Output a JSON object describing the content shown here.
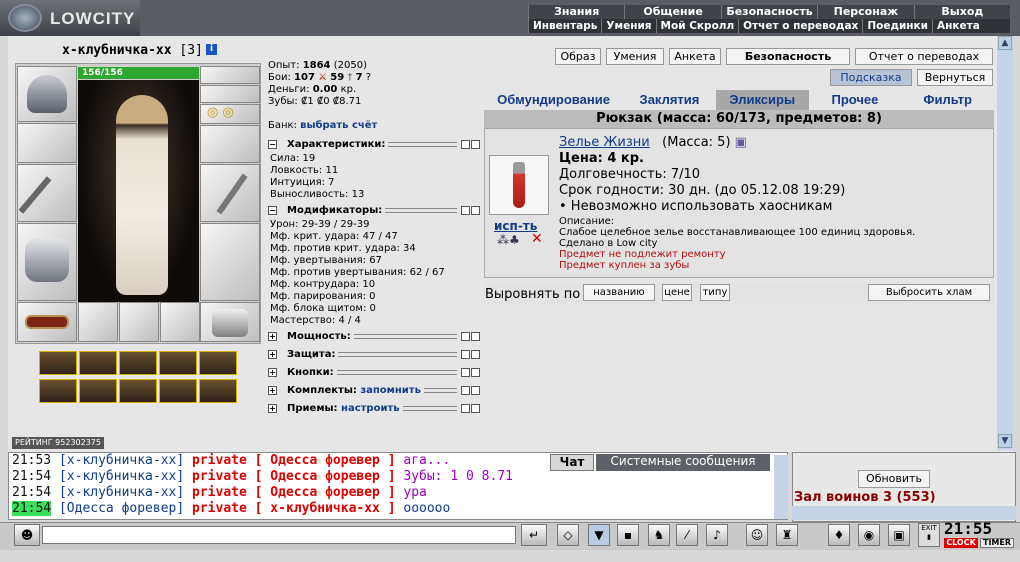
{
  "app": {
    "logo": "LOWCITY"
  },
  "top_menu": [
    "Знания",
    "Общение",
    "Безопасность",
    "Персонаж",
    "Выход"
  ],
  "sub_menu": [
    "Инвентарь",
    "Умения",
    "Мой Скролл",
    "Отчет о переводах",
    "Поединки",
    "Анкета"
  ],
  "character": {
    "name": "х-клубничка-хх",
    "level": "[3]",
    "hp": "156/156",
    "rating": "РЕЙТИНГ 952302375"
  },
  "stats": {
    "exp_label": "Опыт:",
    "exp": "1864",
    "exp_next": "(2050)",
    "fights_label": "Бои:",
    "wins": "107",
    "losses": "59",
    "draws": "7",
    "money_label": "Деньги:",
    "money": "0.00",
    "money_unit": "кр.",
    "teeth_label": "Зубы:",
    "teeth": "₡1 ₡0 ₡8.71",
    "bank_label": "Банк:",
    "bank_link": "выбрать счёт"
  },
  "sections": {
    "chars": "Характеристики:",
    "mods": "Модификаторы:",
    "power": "Мощность:",
    "defense": "Защита:",
    "buttons": "Кнопки:",
    "sets": "Комплекты:",
    "sets_link": "запомнить",
    "moves": "Приемы:",
    "moves_link": "настроить"
  },
  "characteristics": [
    "Сила: 19",
    "Ловкость: 11",
    "Интуиция: 7",
    "Выносливость: 13"
  ],
  "modifiers": [
    "Урон: 29-39 / 29-39",
    "Мф. крит. удара: 47 / 47",
    "Мф. против крит. удара: 34",
    "Мф. увертывания: 67",
    "Мф. против увертывания: 62 / 67",
    "Мф. контрудара: 10",
    "Мф. парирования: 0",
    "Мф. блока щитом: 0",
    "Мастерство: 4 / 4"
  ],
  "buttons": {
    "image": "Образ",
    "skills": "Умения",
    "profile": "Анкета",
    "security": "Безопасность",
    "transfers": "Отчет о переводах",
    "hint": "Подсказка",
    "back": "Вернуться"
  },
  "tabs": [
    "Обмундирование",
    "Заклятия",
    "Эликсиры",
    "Прочее",
    "Фильтр"
  ],
  "backpack": {
    "header": "Рюкзак (масса: 60/173, предметов: 8)"
  },
  "item": {
    "name": "Зелье Жизни",
    "mass": "(Масса: 5)",
    "price": "Цена: 4 кр.",
    "durability": "Долговечность: 7/10",
    "expiry": "Срок годности: 30 дн. (до 05.12.08 19:29)",
    "restriction": "• Невозможно использовать хаосникам",
    "desc_label": "Описание:",
    "desc": "Слабое целебное зелье восстанавливающее 100 единиц здоровья.",
    "made": "Сделано в Low city",
    "no_repair": "Предмет не подлежит ремонту",
    "bought": "Предмет куплен за зубы",
    "use": "исп-ть"
  },
  "sort": {
    "label": "Выровнять по",
    "by_name": "названию",
    "by_price": "цене",
    "by_type": "типу",
    "drop_junk": "Выбросить хлам"
  },
  "chat": {
    "tab_chat": "Чат",
    "tab_system": "Системные сообщения",
    "lines": [
      {
        "time": "21:53",
        "from": "[х-клубничка-хх]",
        "tag": "private",
        "to": "[ Одесса форевер ]",
        "text": "ага..."
      },
      {
        "time": "21:54",
        "from": "[х-клубничка-хх]",
        "tag": "private",
        "to": "[ Одесса форевер ]",
        "text": "Зубы: 1 0 8.71"
      },
      {
        "time": "21:54",
        "from": "[х-клубничка-хх]",
        "tag": "private",
        "to": "[ Одесса форевер ]",
        "text": "ура"
      },
      {
        "time": "21:54",
        "from": "[Одесса форевер]",
        "tag": "private",
        "to": "[ х-клубничка-хх ]",
        "text": "оооооо"
      }
    ]
  },
  "room": {
    "refresh": "Обновить",
    "name": "Зал воинов 3 (553)"
  },
  "clock": {
    "time": "21:55",
    "exit": "EXIT",
    "clock_label": "CLOCK",
    "timer_label": "TIMER"
  }
}
